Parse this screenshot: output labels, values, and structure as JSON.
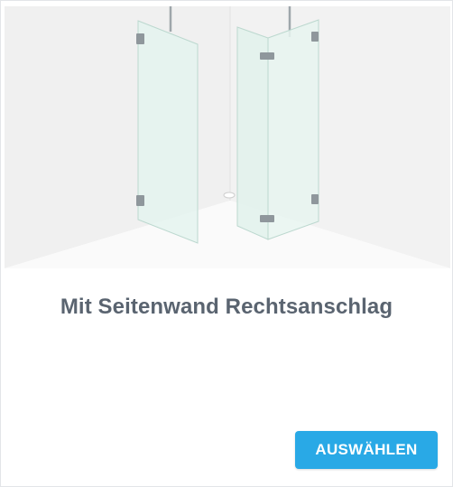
{
  "card": {
    "title": "Mit Seitenwand Rechtsanschlag",
    "button_label": "AUSWÄHLEN",
    "image_icon": "shower-enclosure-illustration"
  },
  "colors": {
    "accent": "#29a9e6",
    "title_text": "#5a6470",
    "wall": "#f0f0f0",
    "glass": "#e6f4ef"
  }
}
